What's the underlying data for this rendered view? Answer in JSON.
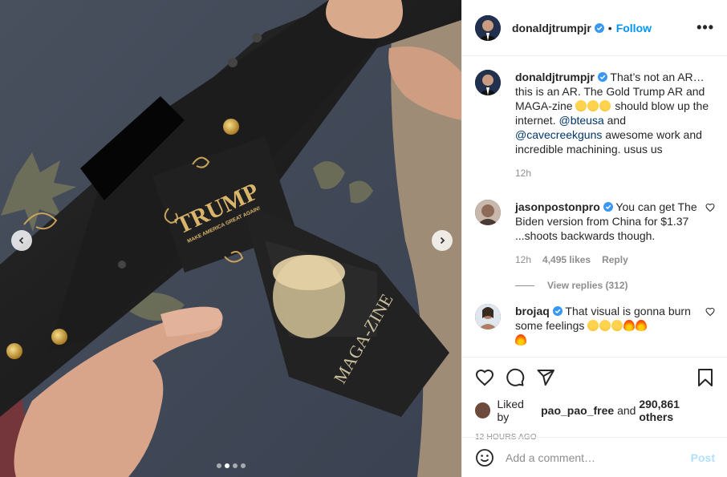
{
  "post": {
    "username": "donaldjtrumpjr",
    "follow_label": "Follow",
    "more_icon": "more-options-icon"
  },
  "media": {
    "engraving_top": "TRUMP",
    "engraving_sub": "MAKE AMERICA GREAT AGAIN!",
    "magazine_text": "MAGA-ZINE",
    "carousel_dots": 4,
    "carousel_active": 2
  },
  "caption": {
    "username": "donaldjtrumpjr",
    "text_1": "That’s not an AR… this is an AR. The Gold Trump AR and MAGA-zine ",
    "text_2": " should blow up the internet. ",
    "mention_1": "@bteusa",
    "text_3": " and ",
    "mention_2": "@cavecreekguns",
    "text_4": " awesome work and incredible machining. usus us",
    "time": "12h"
  },
  "comments": [
    {
      "username": "jasonpostonpro",
      "text": "You can get The Biden version from China for $1.37 ...shoots backwards though.",
      "time": "12h",
      "likes": "4,495 likes",
      "reply": "Reply",
      "view_replies": "View replies (312)"
    },
    {
      "username": "brojaq",
      "text": "That visual is gonna burn some feelings "
    }
  ],
  "actions": {
    "liked_by_prefix": "Liked by",
    "liked_by_user": "pao_pao_free",
    "liked_by_and": "and",
    "others": "290,861 others",
    "timestamp": "12 HOURS AGO"
  },
  "add_comment": {
    "placeholder": "Add a comment…",
    "post_label": "Post"
  },
  "colors": {
    "accent": "#0095f6",
    "mention": "#00376b",
    "muted": "#8e8e8e",
    "post_disabled": "#b2dffc",
    "verified": "#3897f0"
  }
}
